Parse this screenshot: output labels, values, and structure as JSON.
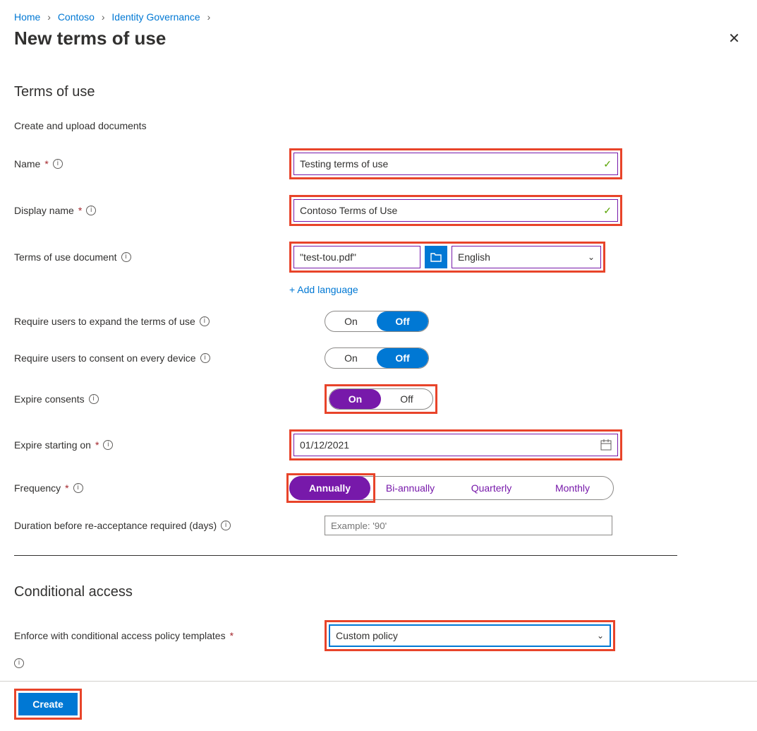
{
  "breadcrumb": {
    "items": [
      "Home",
      "Contoso",
      "Identity Governance"
    ]
  },
  "page_title": "New terms of use",
  "section1_title": "Terms of use",
  "subhead": "Create and upload documents",
  "labels": {
    "name": "Name",
    "display_name": "Display name",
    "tou_doc": "Terms of use document",
    "require_expand": "Require users to expand the terms of use",
    "require_consent": "Require users to consent on every device",
    "expire_consents": "Expire consents",
    "expire_starting": "Expire starting on",
    "frequency": "Frequency",
    "duration_reaccept": "Duration before re-acceptance required (days)",
    "enforce_ca": "Enforce with conditional access policy templates"
  },
  "values": {
    "name": "Testing terms of use",
    "display_name": "Contoso Terms of Use",
    "doc_file": "\"test-tou.pdf\"",
    "doc_lang": "English",
    "expire_date": "01/12/2021",
    "ca_template": "Custom policy"
  },
  "toggle": {
    "on": "On",
    "off": "Off"
  },
  "freq_options": [
    "Annually",
    "Bi-annually",
    "Quarterly",
    "Monthly"
  ],
  "freq_selected": "Annually",
  "duration_placeholder": "Example: '90'",
  "add_language": "+ Add language",
  "section2_title": "Conditional access",
  "create_label": "Create"
}
